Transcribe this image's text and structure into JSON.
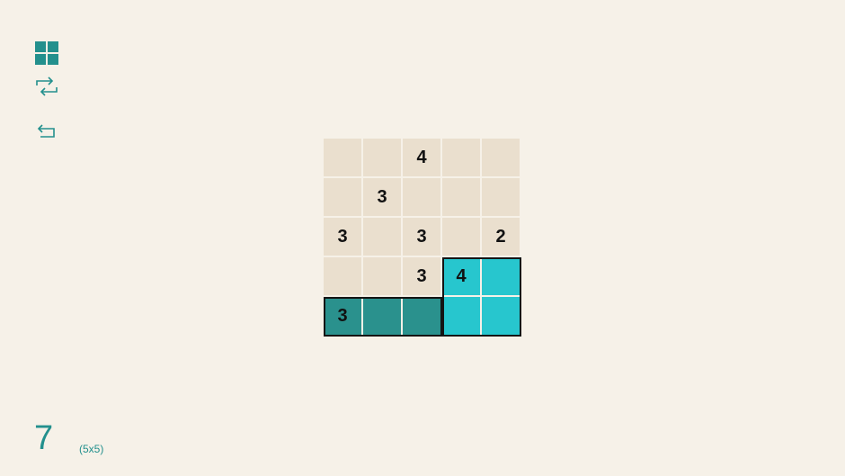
{
  "toolbar": {
    "menu_icon": "grid-menu-icon",
    "shuffle_icon": "shuffle-icon",
    "undo_icon": "undo-icon",
    "icon_color": "#23908d"
  },
  "board": {
    "rows": 5,
    "cols": 5,
    "cells": [
      [
        "",
        "",
        "4",
        "",
        ""
      ],
      [
        "",
        "3",
        "",
        "",
        ""
      ],
      [
        "3",
        "",
        "3",
        "",
        "2"
      ],
      [
        "",
        "",
        "3",
        "4",
        ""
      ],
      [
        "3",
        "",
        "",
        "",
        ""
      ]
    ],
    "fills": [
      [
        "",
        "",
        "",
        "",
        ""
      ],
      [
        "",
        "",
        "",
        "",
        ""
      ],
      [
        "",
        "",
        "",
        "",
        ""
      ],
      [
        "",
        "",
        "",
        "light",
        "light"
      ],
      [
        "dark",
        "dark",
        "dark",
        "light",
        "light"
      ]
    ],
    "regions": [
      {
        "row": 4,
        "col": 0,
        "rows": 1,
        "cols": 3,
        "color": "dark"
      },
      {
        "row": 3,
        "col": 3,
        "rows": 2,
        "cols": 2,
        "color": "light"
      }
    ],
    "colors": {
      "empty": "#eadfce",
      "dark": "#2a918d",
      "light": "#27c6ce"
    }
  },
  "level": {
    "number": "7",
    "size": "(5x5)"
  }
}
